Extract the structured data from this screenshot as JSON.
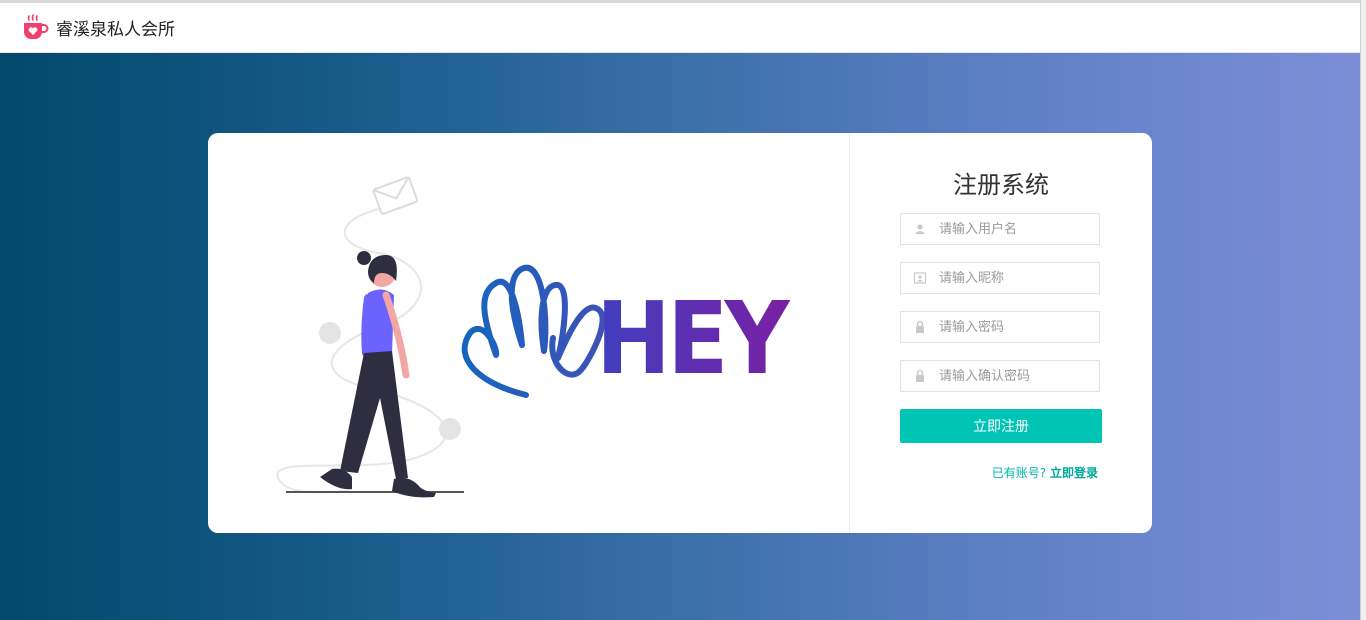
{
  "header": {
    "site_title": "睿溪泉私人会所",
    "logo_icon": "coffee-cup-heart-icon",
    "logo_color": "#f0416e"
  },
  "background": {
    "gradient_start": "#01496b",
    "gradient_end": "#7c8ed7"
  },
  "illustration": {
    "hey_text": "HEY",
    "icons": [
      "envelope-icon",
      "waving-hand-icon"
    ]
  },
  "form": {
    "title": "注册系统",
    "fields": [
      {
        "icon": "user-icon",
        "placeholder": "请输入用户名",
        "value": ""
      },
      {
        "icon": "id-card-icon",
        "placeholder": "请输入昵称",
        "value": ""
      },
      {
        "icon": "lock-icon",
        "placeholder": "请输入密码",
        "value": ""
      },
      {
        "icon": "lock-icon",
        "placeholder": "请输入确认密码",
        "value": ""
      }
    ],
    "submit_label": "立即注册",
    "has_account_text": "已有账号?",
    "login_link": "立即登录",
    "accent_color": "#00c4b4"
  }
}
